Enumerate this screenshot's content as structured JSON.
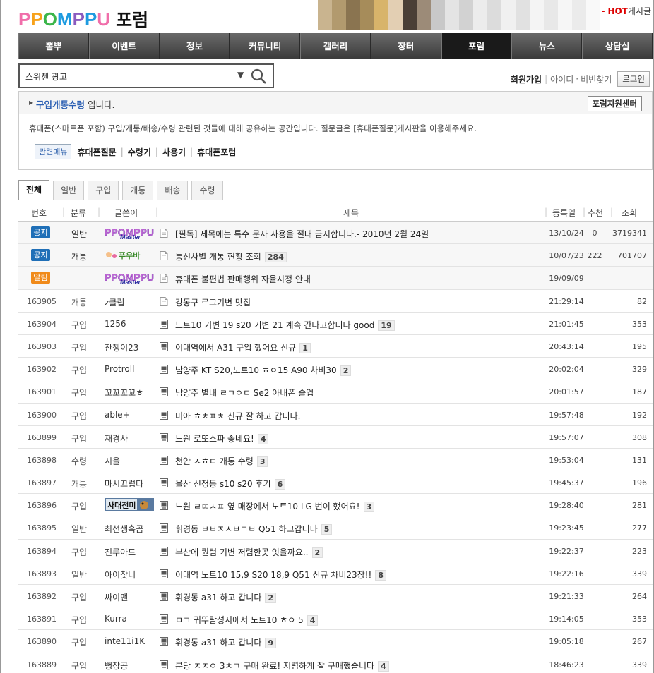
{
  "header": {
    "logo_text": "PPOMPPU",
    "logo_letters": [
      {
        "ch": "P",
        "color": "#f06eaa"
      },
      {
        "ch": "P",
        "color": "#f7a21b"
      },
      {
        "ch": "O",
        "color": "#3bb54a"
      },
      {
        "ch": "M",
        "color": "#1e9be0"
      },
      {
        "ch": "P",
        "color": "#8a5bbf"
      },
      {
        "ch": "P",
        "color": "#1e9be0"
      },
      {
        "ch": "U",
        "color": "#f06eaa"
      }
    ],
    "forum_label": "포럼"
  },
  "nav": [
    "뽐뿌",
    "이벤트",
    "정보",
    "커뮤니티",
    "갤러리",
    "장터",
    "포럼",
    "뉴스",
    "상담실"
  ],
  "nav_active": 6,
  "search": {
    "value": "스위첸 광고",
    "dropdown_glyph": "▼"
  },
  "userlinks": {
    "join": "회원가입",
    "id": "아이디",
    "dot": "·",
    "pw": "비번찾기",
    "login": "로그인"
  },
  "board": {
    "category": "구입개통수령",
    "suffix": " 입니다.",
    "support_button": "포럼지원센터",
    "description": "휴대폰(스마트폰 포함) 구입/개통/배송/수령 관련된 것들에 대해 공유하는 공간입니다. 질문글은 [휴대폰질문]게시판을 이용해주세요.",
    "related_tag": "관련메뉴",
    "related": [
      "휴대폰질문",
      "수령기",
      "사용기",
      "휴대폰포럼"
    ]
  },
  "tabs": [
    "전체",
    "일반",
    "구입",
    "개통",
    "배송",
    "수령"
  ],
  "hot": {
    "dash": "-",
    "hot": "HOT",
    "label": "게시글"
  },
  "columns": {
    "num": "번호",
    "cat": "분류",
    "author": "글쓴이",
    "title": "제목",
    "date": "등록일",
    "rec": "추천",
    "views": "조회"
  },
  "notices": [
    {
      "badge": "공지",
      "badge_color": "blue",
      "cat": "일반",
      "author_img": "Master",
      "title": "[필독] 제목에는 특수 문자 사용을 절대 금지합니다.- 2010년 2월 24일",
      "count": "",
      "date": "13/10/24",
      "rec": "0",
      "views": "3719341"
    },
    {
      "badge": "공지",
      "badge_color": "blue",
      "cat": "개통",
      "author_img": "푸우바",
      "title": "통신사별 개통 현황 조회",
      "count": "284",
      "date": "10/07/23",
      "rec": "222",
      "views": "701707"
    },
    {
      "badge": "알림",
      "badge_color": "orange",
      "cat": "",
      "author_img": "Master",
      "title": "휴대폰 불편법 판매행위 자율시정 안내",
      "count": "",
      "date": "19/09/09",
      "rec": "",
      "views": ""
    }
  ],
  "posts": [
    {
      "num": "163905",
      "cat": "개통",
      "author": "z클립",
      "title": "강동구 르그기변 맛집",
      "count": "",
      "date": "21:29:14",
      "rec": "",
      "views": "82"
    },
    {
      "num": "163904",
      "cat": "구입",
      "author": "1256",
      "title": "노트10 기변 19 s20 기변 21 계속 간다고합니다 good",
      "count": "19",
      "date": "21:01:45",
      "rec": "",
      "views": "353"
    },
    {
      "num": "163903",
      "cat": "구입",
      "author": "잔챙이23",
      "title": "이대역에서 A31 구입 했어요 신규",
      "count": "1",
      "date": "20:43:14",
      "rec": "",
      "views": "195"
    },
    {
      "num": "163902",
      "cat": "구입",
      "author": "Protroll",
      "title": "남양주 KT S20,노트10 ㅎㅇ15 A90 차비30",
      "count": "2",
      "date": "20:02:04",
      "rec": "",
      "views": "329"
    },
    {
      "num": "163901",
      "cat": "구입",
      "author": "꼬꼬꼬꼬ㅎ",
      "title": "남양주 별내 ㄹㄱㅇㄷ Se2 아내폰 졸업",
      "count": "",
      "date": "20:01:57",
      "rec": "",
      "views": "187"
    },
    {
      "num": "163900",
      "cat": "구입",
      "author": "able+",
      "title": "미아 ㅎㅊㅍㅊ 신규 잘 하고 갑니다.",
      "count": "",
      "date": "19:57:48",
      "rec": "",
      "views": "192"
    },
    {
      "num": "163899",
      "cat": "구입",
      "author": "재경사",
      "title": "노원 로또스파 좋네요!",
      "count": "4",
      "date": "19:57:07",
      "rec": "",
      "views": "308"
    },
    {
      "num": "163898",
      "cat": "수령",
      "author": "시을",
      "title": "천안 ㅅㅎㄷ 개통 수령",
      "count": "3",
      "date": "19:53:04",
      "rec": "",
      "views": "131"
    },
    {
      "num": "163897",
      "cat": "개통",
      "author": "마시끄럽다",
      "title": "울산 신정동 s10 s20 후기",
      "count": "6",
      "date": "19:45:37",
      "rec": "",
      "views": "196"
    },
    {
      "num": "163896",
      "cat": "구입",
      "author": "",
      "author_img": "사대전미",
      "title": "노원 ㄹㄸㅅㅍ 옆 매장에서 노트10 LG 번이 했어요!",
      "count": "3",
      "date": "19:28:40",
      "rec": "",
      "views": "281"
    },
    {
      "num": "163895",
      "cat": "일반",
      "author": "최선생흑곰",
      "title": "휘경동 ㅂㅂㅈㅅㅂㄱㅂ Q51 하고갑니다",
      "count": "5",
      "date": "19:23:45",
      "rec": "",
      "views": "277"
    },
    {
      "num": "163894",
      "cat": "구입",
      "author": "진루아드",
      "title": "부산에 퀀텀 기변 저렴한곳 잇을까요..",
      "count": "2",
      "date": "19:22:37",
      "rec": "",
      "views": "223"
    },
    {
      "num": "163893",
      "cat": "일반",
      "author": "아이찾니",
      "title": "이대역 노트10 15,9 S20 18,9 Q51 신규 차비23장!!",
      "count": "8",
      "date": "19:22:16",
      "rec": "",
      "views": "339"
    },
    {
      "num": "163892",
      "cat": "구입",
      "author": "싸이맨",
      "title": "휘경동 a31 하고 갑니다",
      "count": "2",
      "date": "19:21:33",
      "rec": "",
      "views": "264"
    },
    {
      "num": "163891",
      "cat": "구입",
      "author": "Kurra",
      "title": "ㅁㄱ 귀뚜람성지에서 노트10 ㅎㅇ 5",
      "count": "4",
      "date": "19:14:05",
      "rec": "",
      "views": "353"
    },
    {
      "num": "163890",
      "cat": "구입",
      "author": "inte11i1K",
      "title": "휘경동 a31 하고 갑니다",
      "count": "9",
      "date": "19:05:18",
      "rec": "",
      "views": "267"
    },
    {
      "num": "163889",
      "cat": "구입",
      "author": "뻥장공",
      "title": "분당 ㅈㅈㅇ 3ㅊㄱ 구매 완료! 저렴하게 잘 구매했습니다",
      "count": "4",
      "date": "18:46:23",
      "rec": "",
      "views": "339"
    }
  ]
}
